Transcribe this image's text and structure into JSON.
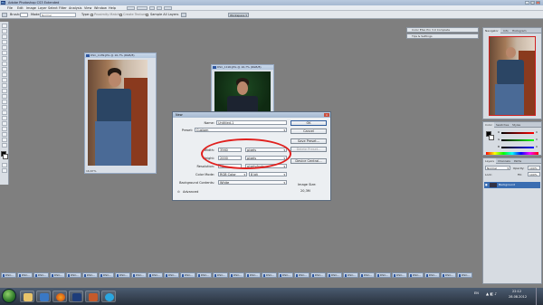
{
  "app": {
    "title": "Adobe Photoshop CS3 Extended",
    "logo": "Ps",
    "window_controls": [
      "–",
      "□",
      "×"
    ]
  },
  "menu": {
    "items": [
      "File",
      "Edit",
      "Image",
      "Layer",
      "Select",
      "Filter",
      "Analysis",
      "View",
      "Window",
      "Help"
    ]
  },
  "options_bar": {
    "brush_label": "Brush:",
    "mode_label": "Mode:",
    "mode_value": "Normal",
    "type_label": "Type:",
    "proximity_label": "Proximity Match",
    "texture_label": "Create Texture",
    "sample_all_label": "Sample All Layers",
    "workspace_label": "Workspace ▾"
  },
  "documents": [
    {
      "title": "DSC_1189.JPG @ 16,7% (RGB/8)",
      "zoom": "16,67%"
    },
    {
      "title": "DSC_1190.JPG @ 16,7% (RGB/8)",
      "zoom": ""
    }
  ],
  "dialog": {
    "title": "New",
    "name_label": "Name:",
    "name_value": "Untitled-1",
    "preset_label": "Preset:",
    "preset_value": "Custom",
    "width_label": "Width:",
    "width_value": "3560",
    "width_unit": "pixels",
    "height_label": "Height:",
    "height_value": "2000",
    "height_unit": "pixels",
    "resolution_label": "Resolution:",
    "resolution_value": "72",
    "resolution_unit": "pixels/inch",
    "color_mode_label": "Color Mode:",
    "color_mode_value": "RGB Color",
    "bit_depth_value": "8 bit",
    "bg_label": "Background Contents:",
    "bg_value": "White",
    "advanced_label": "Advanced",
    "image_size_label": "Image Size:",
    "image_size_value": "20,3M",
    "buttons": {
      "ok": "OK",
      "cancel": "Cancel",
      "save_preset": "Save Preset...",
      "delete_preset": "Delete Preset...",
      "device_central": "Device Central..."
    }
  },
  "right_panels": {
    "color_efex": "Color Efex Pro 3.0 Complete",
    "tips": "Tips & Settings",
    "navigator_tabs": [
      "Navigator",
      "Info",
      "Histogram"
    ],
    "color_tabs": [
      "Color",
      "Swatches",
      "Styles"
    ],
    "color_channels": [
      "R",
      "G",
      "B"
    ],
    "color_values": [
      "0",
      "0",
      "0"
    ],
    "layers_tabs": [
      "Layers",
      "Channels",
      "Paths"
    ],
    "blend_mode": "Normal",
    "opacity_label": "Opacity:",
    "opacity_value": "100%",
    "lock_label": "Lock:",
    "fill_label": "Fill:",
    "fill_value": "100%",
    "layer_name": "Background"
  },
  "minimized_docs": [
    "DSC...",
    "DSC...",
    "DSC...",
    "DSC...",
    "DSC...",
    "DSC...",
    "DSC...",
    "DSC...",
    "DSC...",
    "DSC...",
    "DSC...",
    "DSC...",
    "DSC...",
    "DSC...",
    "DSC...",
    "DSC...",
    "DSC...",
    "DSC...",
    "DSC...",
    "DSC...",
    "DSC...",
    "DSC...",
    "DSC...",
    "DSC...",
    "DSC...",
    "DSC...",
    "DSC...",
    "DSC...",
    "DSC...",
    "DSC..."
  ],
  "taskbar": {
    "lang": "EN",
    "time": "22:12",
    "date": "28.08.2012"
  }
}
